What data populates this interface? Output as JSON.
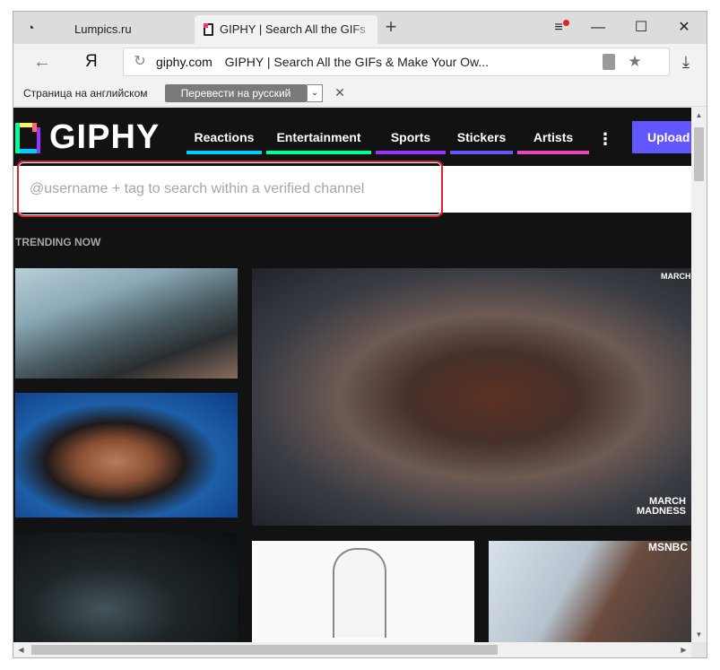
{
  "tabs": [
    {
      "title": "Lumpics.ru",
      "active": false
    },
    {
      "title": "GIPHY | Search All the GIFs",
      "active": true
    }
  ],
  "icons": {
    "browser_menu": "browser-logo-icon",
    "new_tab": "plus-icon",
    "settings": "hamburger-menu-icon",
    "minimize": "minimize-icon",
    "maximize": "maximize-icon",
    "close": "close-icon",
    "back": "arrow-left-icon",
    "reload": "reload-icon",
    "lock": "lock-icon",
    "bookmark": "star-icon",
    "download": "download-icon"
  },
  "glyphs": {
    "browser_menu": "◔",
    "new_tab": "+",
    "settings": "≡",
    "minimize": "—",
    "maximize": "☐",
    "close": "✕",
    "back": "←",
    "ya": "Я",
    "reload": "↻",
    "star": "★",
    "download": "⤓",
    "dropdown": "⌄",
    "dismiss": "✕",
    "more": "⋮",
    "scroll_up": "▲",
    "scroll_down": "▼",
    "scroll_left": "◀",
    "scroll_right": "▶"
  },
  "address_bar": {
    "domain": "giphy.com",
    "page_title": "GIPHY | Search All the GIFs & Make Your Ow..."
  },
  "translate_bar": {
    "label": "Страница на английском",
    "button": "Перевести на русский"
  },
  "giphy": {
    "logo_text": "GIPHY",
    "nav": [
      {
        "label": "Reactions",
        "color": "#00ccff"
      },
      {
        "label": "Entertainment",
        "color": "#00ff99"
      },
      {
        "label": "Sports",
        "color": "#9933ff"
      },
      {
        "label": "Stickers",
        "color": "#6157ff"
      },
      {
        "label": "Artists",
        "color": "#e646b6"
      }
    ],
    "upload_label": "Upload",
    "search_placeholder": "@username + tag to search within a verified channel",
    "trending_label": "TRENDING NOW",
    "gif_badges": {
      "march_madness_top": "MARCH",
      "march_madness_bottom": "MARCH MADNESS",
      "msnbc": "MSNBC"
    }
  },
  "colors": {
    "page_bg": "#121212",
    "upload": "#6157ff",
    "highlight": "#d8262e"
  }
}
